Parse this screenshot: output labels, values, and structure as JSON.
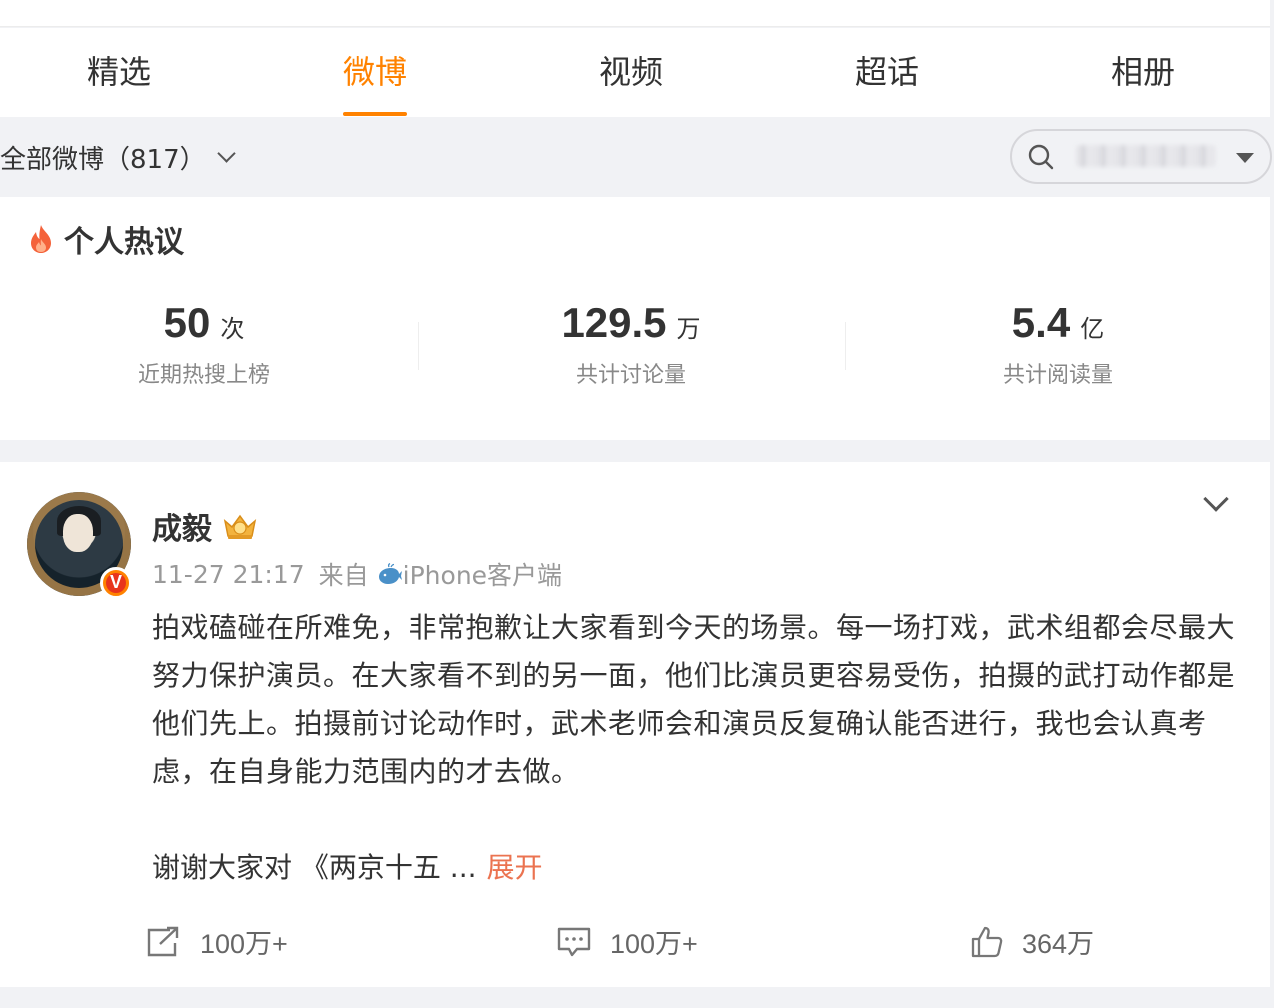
{
  "tabs": [
    {
      "label": "精选"
    },
    {
      "label": "微博"
    },
    {
      "label": "视频"
    },
    {
      "label": "超话"
    },
    {
      "label": "相册"
    }
  ],
  "active_tab": "微博",
  "filter": {
    "label": "全部微博（817）"
  },
  "search": {
    "icon": "search-icon",
    "placeholder": ""
  },
  "hot": {
    "title": "个人热议",
    "icon": "fire-icon",
    "stats": [
      {
        "value": "50",
        "unit": "次",
        "label": "近期热搜上榜"
      },
      {
        "value": "129.5",
        "unit": "万",
        "label": "共计讨论量"
      },
      {
        "value": "5.4",
        "unit": "亿",
        "label": "共计阅读量"
      }
    ]
  },
  "post": {
    "author": "成毅",
    "verified_badge": "V",
    "time": "11-27 21:17",
    "from_label": "来自",
    "device": "iPhone客户端",
    "content": "拍戏磕碰在所难免，非常抱歉让大家看到今天的场景。每一场打戏，武术组都会尽最大努力保护演员。在大家看不到的另一面，他们比演员更容易受伤，拍摄的武打动作都是他们先上。拍摄前讨论动作时，武术老师会和演员反复确认能否进行，我也会认真考虑，在自身能力范围内的才去做。",
    "truncated": "谢谢大家对 《两京十五  ...",
    "expand_label": "展开",
    "actions": {
      "repost": "100万+",
      "comment": "100万+",
      "like": "364万"
    }
  },
  "colors": {
    "accent": "#ff8200",
    "expand": "#eb7350",
    "background": "#f1f2f5"
  }
}
